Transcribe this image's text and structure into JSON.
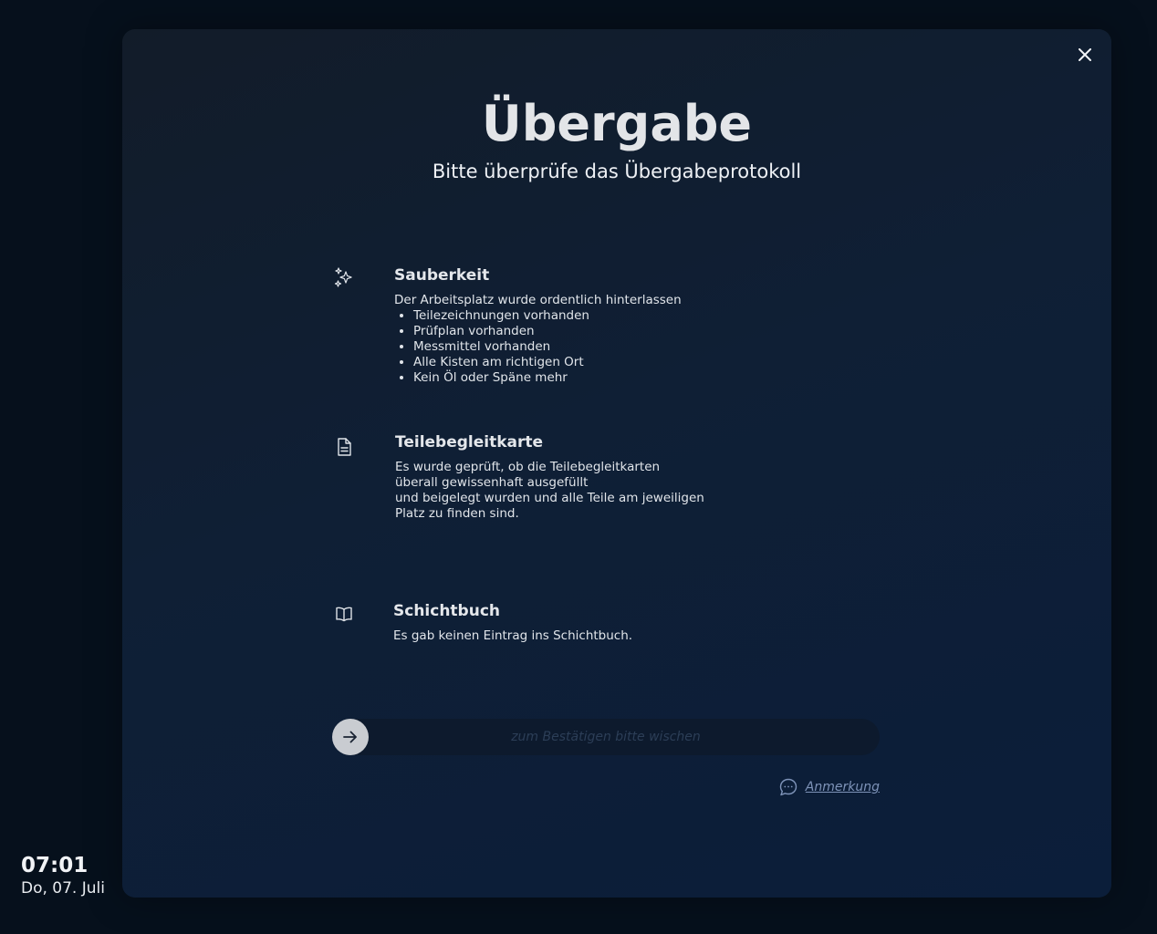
{
  "modal": {
    "title": "Übergabe",
    "subtitle": "Bitte überprüfe das Übergabeprotokoll",
    "close_icon": "close-icon"
  },
  "sections": [
    {
      "icon": "sparkles-icon",
      "heading": "Sauberkeit",
      "text": "Der Arbeitsplatz wurde ordentlich hinterlassen",
      "items": [
        "Teilezeichnungen vorhanden",
        "Prüfplan vorhanden",
        "Messmittel vorhanden",
        "Alle Kisten am richtigen Ort",
        "Kein Öl oder Späne mehr"
      ]
    },
    {
      "icon": "document-icon",
      "heading": "Teilebegleitkarte",
      "lines": [
        "Es wurde geprüft, ob die Teilebegleitkarten",
        "überall gewissenhaft ausgefüllt",
        "und beigelegt wurden und alle Teile am jeweiligen",
        "Platz zu finden sind."
      ]
    },
    {
      "icon": "book-icon",
      "heading": "Schichtbuch",
      "text": "Es gab keinen Eintrag ins Schichtbuch."
    }
  ],
  "swipe": {
    "label": "zum Bestätigen bitte wischen",
    "handle_icon": "arrow-right-icon"
  },
  "note": {
    "label": "Anmerkung",
    "icon": "chat-bubble-icon"
  },
  "clock": {
    "time": "07:01",
    "date": "Do, 07. Juli"
  },
  "colors": {
    "background": "#06101c",
    "modal_gradient_start": "#121c29",
    "modal_gradient_end": "#0b1e3a",
    "accent_link": "#7e93b8",
    "swipe_handle": "#c9ccd1"
  }
}
